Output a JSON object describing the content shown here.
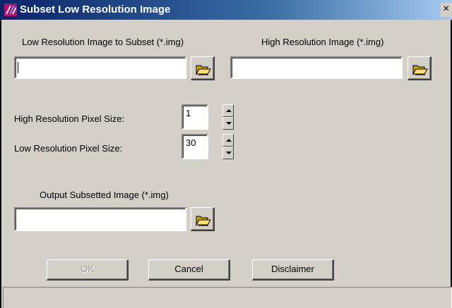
{
  "window": {
    "title": "Subset Low Resolution Image",
    "close_label": "×"
  },
  "low_res_input": {
    "label": "Low Resolution Image to Subset (*.img)",
    "value": ""
  },
  "high_res_input": {
    "label": "High Resolution Image (*.img)",
    "value": ""
  },
  "high_res_pixel": {
    "label": "High Resolution Pixel Size:",
    "value": "1"
  },
  "low_res_pixel": {
    "label": "Low Resolution Pixel Size:",
    "value": "30"
  },
  "output_input": {
    "label": "Output Subsetted Image (*.img)",
    "value": ""
  },
  "buttons": {
    "ok": "OK",
    "cancel": "Cancel",
    "disclaimer": "Disclaimer"
  },
  "icons": {
    "app": "app-icon",
    "browse": "folder-open-icon"
  }
}
